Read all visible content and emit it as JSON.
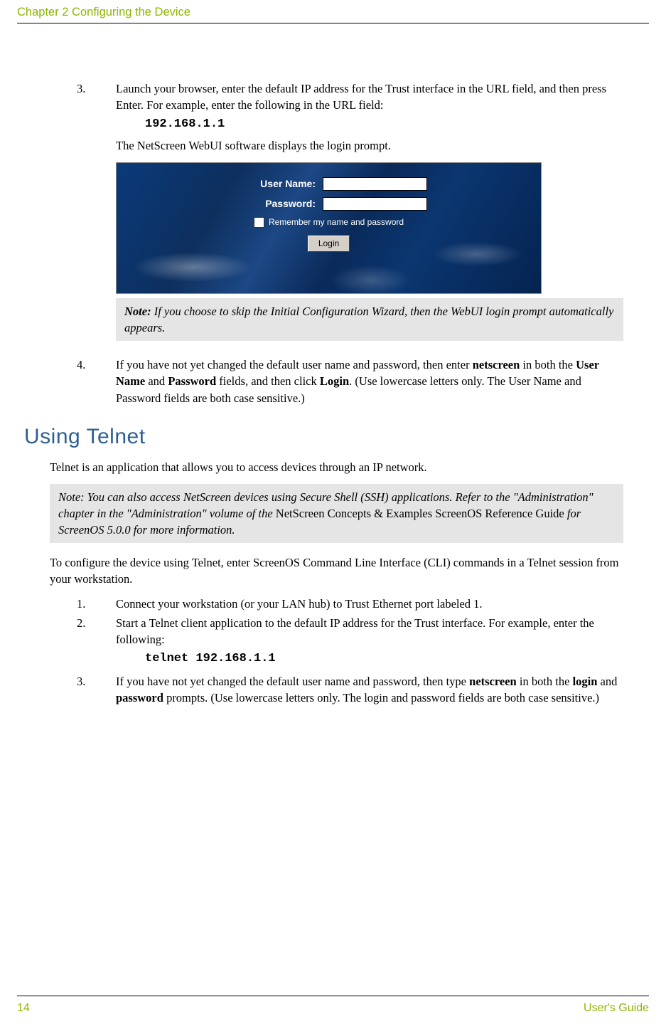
{
  "header": {
    "chapter_title": "Chapter 2 Configuring the Device"
  },
  "step3": {
    "num": "3.",
    "text_part1": "Launch your browser, enter the default IP address for the Trust interface in the URL field, and then press Enter. For example, enter the following in the URL field:",
    "code": "192.168.1.1",
    "after": "The NetScreen WebUI software displays the login prompt."
  },
  "login_form": {
    "username_label": "User Name:",
    "username_value": "",
    "password_label": "Password:",
    "password_value": "",
    "remember_label": "Remember my name and password",
    "login_button": "Login"
  },
  "note1": {
    "lead": "Note:",
    "text": " If you choose to skip the Initial Configuration Wizard, then the WebUI login prompt automatically appears."
  },
  "step4": {
    "num": "4.",
    "t1": "If you have not yet changed the default user name and password, then enter ",
    "b1": "netscreen",
    "t2": " in both the ",
    "b2": "User Name",
    "t3": " and ",
    "b3": "Password",
    "t4": " fields, and then click ",
    "b4": "Login",
    "t5": ". (Use lowercase letters only. The User Name and Password fields are both case sensitive.)"
  },
  "section_heading": "Using Telnet",
  "telnet_intro": "Telnet is an application that allows you to access devices through an IP network.",
  "note2": {
    "lead": "Note:",
    "t1": " You can also access NetScreen devices using Secure Shell (SSH) applications. Refer to the \"Administration\" chapter in the \"Administration\" volume of the ",
    "r1": "NetScreen Concepts & Examples ScreenOS Reference Guide",
    "t2": " for ScreenOS 5.0.0 for more information."
  },
  "telnet_config": "To configure the device using Telnet, enter ScreenOS Command Line Interface (CLI) commands in a Telnet session from your workstation.",
  "tstep1": {
    "num": "1.",
    "text": "Connect your workstation (or your LAN hub) to Trust Ethernet port labeled 1."
  },
  "tstep2": {
    "num": "2.",
    "text": "Start a Telnet client application to the default IP address for the Trust interface. For example, enter the following:",
    "code": "telnet 192.168.1.1"
  },
  "tstep3": {
    "num": "3.",
    "t1": "If you have not yet changed the default user name and password, then type ",
    "b1": "netscreen",
    "t2": " in both the ",
    "b2": "login",
    "t3": " and ",
    "b3": "password",
    "t4": " prompts. (Use lowercase letters only. The login and password fields are both case sensitive.)"
  },
  "footer": {
    "page_num": "14",
    "doc_title": "User's Guide"
  }
}
